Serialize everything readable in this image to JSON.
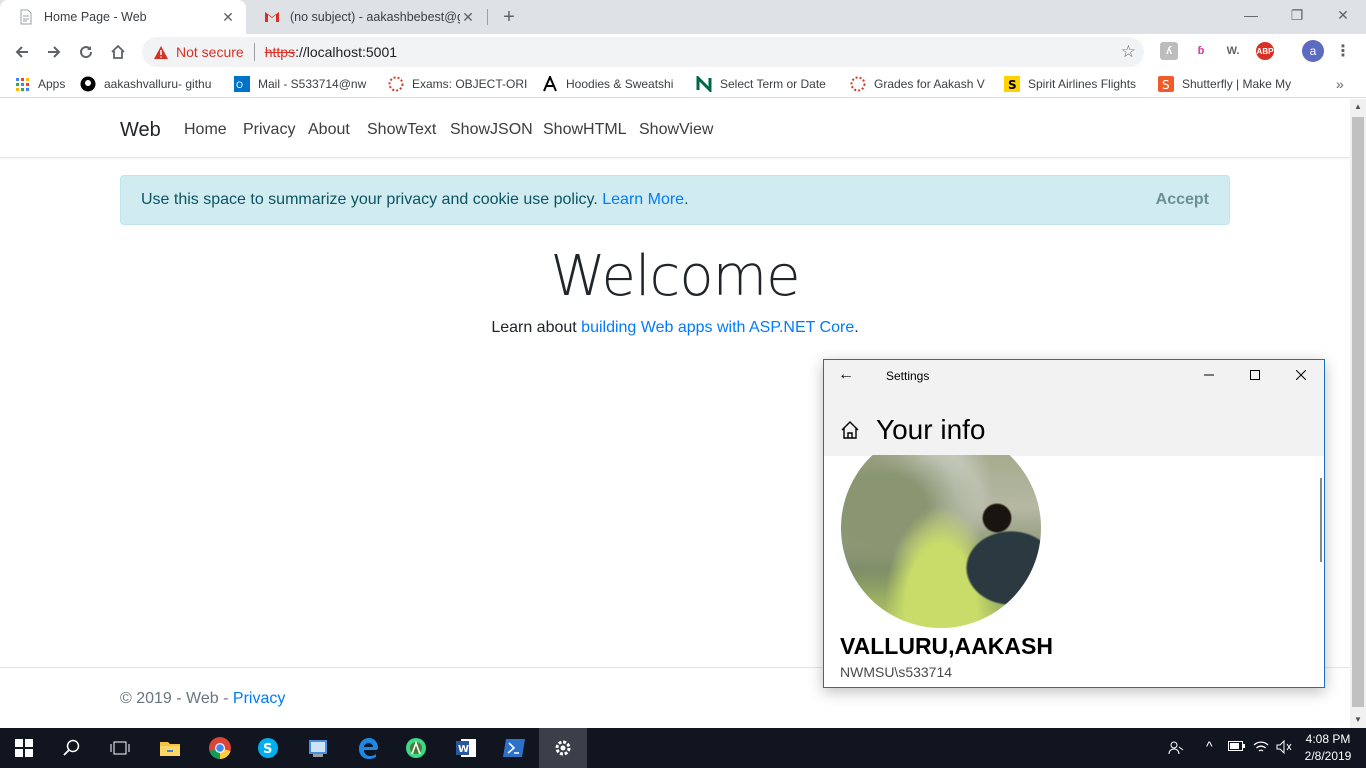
{
  "browser": {
    "tabs": [
      {
        "title": "Home Page - Web"
      },
      {
        "title": "(no subject) - aakashbebest@gm"
      }
    ],
    "security_label": "Not secure",
    "url_scheme": "https",
    "url_host": "://localhost:5001",
    "bookmarks": [
      "Apps",
      "aakashvalluru- githu",
      "Mail - S533714@nw",
      "Exams: OBJECT-ORIE",
      "Hoodies & Sweatshi",
      "Select Term or Date",
      "Grades for Aakash V",
      "Spirit Airlines Flights",
      "Shutterfly | Make My"
    ],
    "profile_initial": "a",
    "extensions": [
      "ABP"
    ]
  },
  "site": {
    "brand": "Web",
    "nav": [
      "Home",
      "Privacy",
      "About",
      "ShowText",
      "ShowJSON",
      "ShowHTML",
      "ShowView"
    ],
    "cookie_text": "Use this space to summarize your privacy and cookie use policy.",
    "cookie_link": "Learn More",
    "cookie_accept": "Accept",
    "welcome": "Welcome",
    "learn_prefix": "Learn about",
    "learn_link": "building Web apps with ASP.NET Core",
    "footer_prefix": "© 2019 - Web -",
    "footer_link": "Privacy"
  },
  "settings": {
    "window_title": "Settings",
    "heading": "Your info",
    "user_name": "VALLURU,AAKASH",
    "user_account": "NWMSU\\s533714"
  },
  "taskbar": {
    "time": "4:08 PM",
    "date": "2/8/2019"
  },
  "colors": {
    "link": "#007bff",
    "cookie_bg": "#d1ecf1",
    "taskbar_bg": "#101520",
    "settings_border": "#1f6fbf"
  }
}
